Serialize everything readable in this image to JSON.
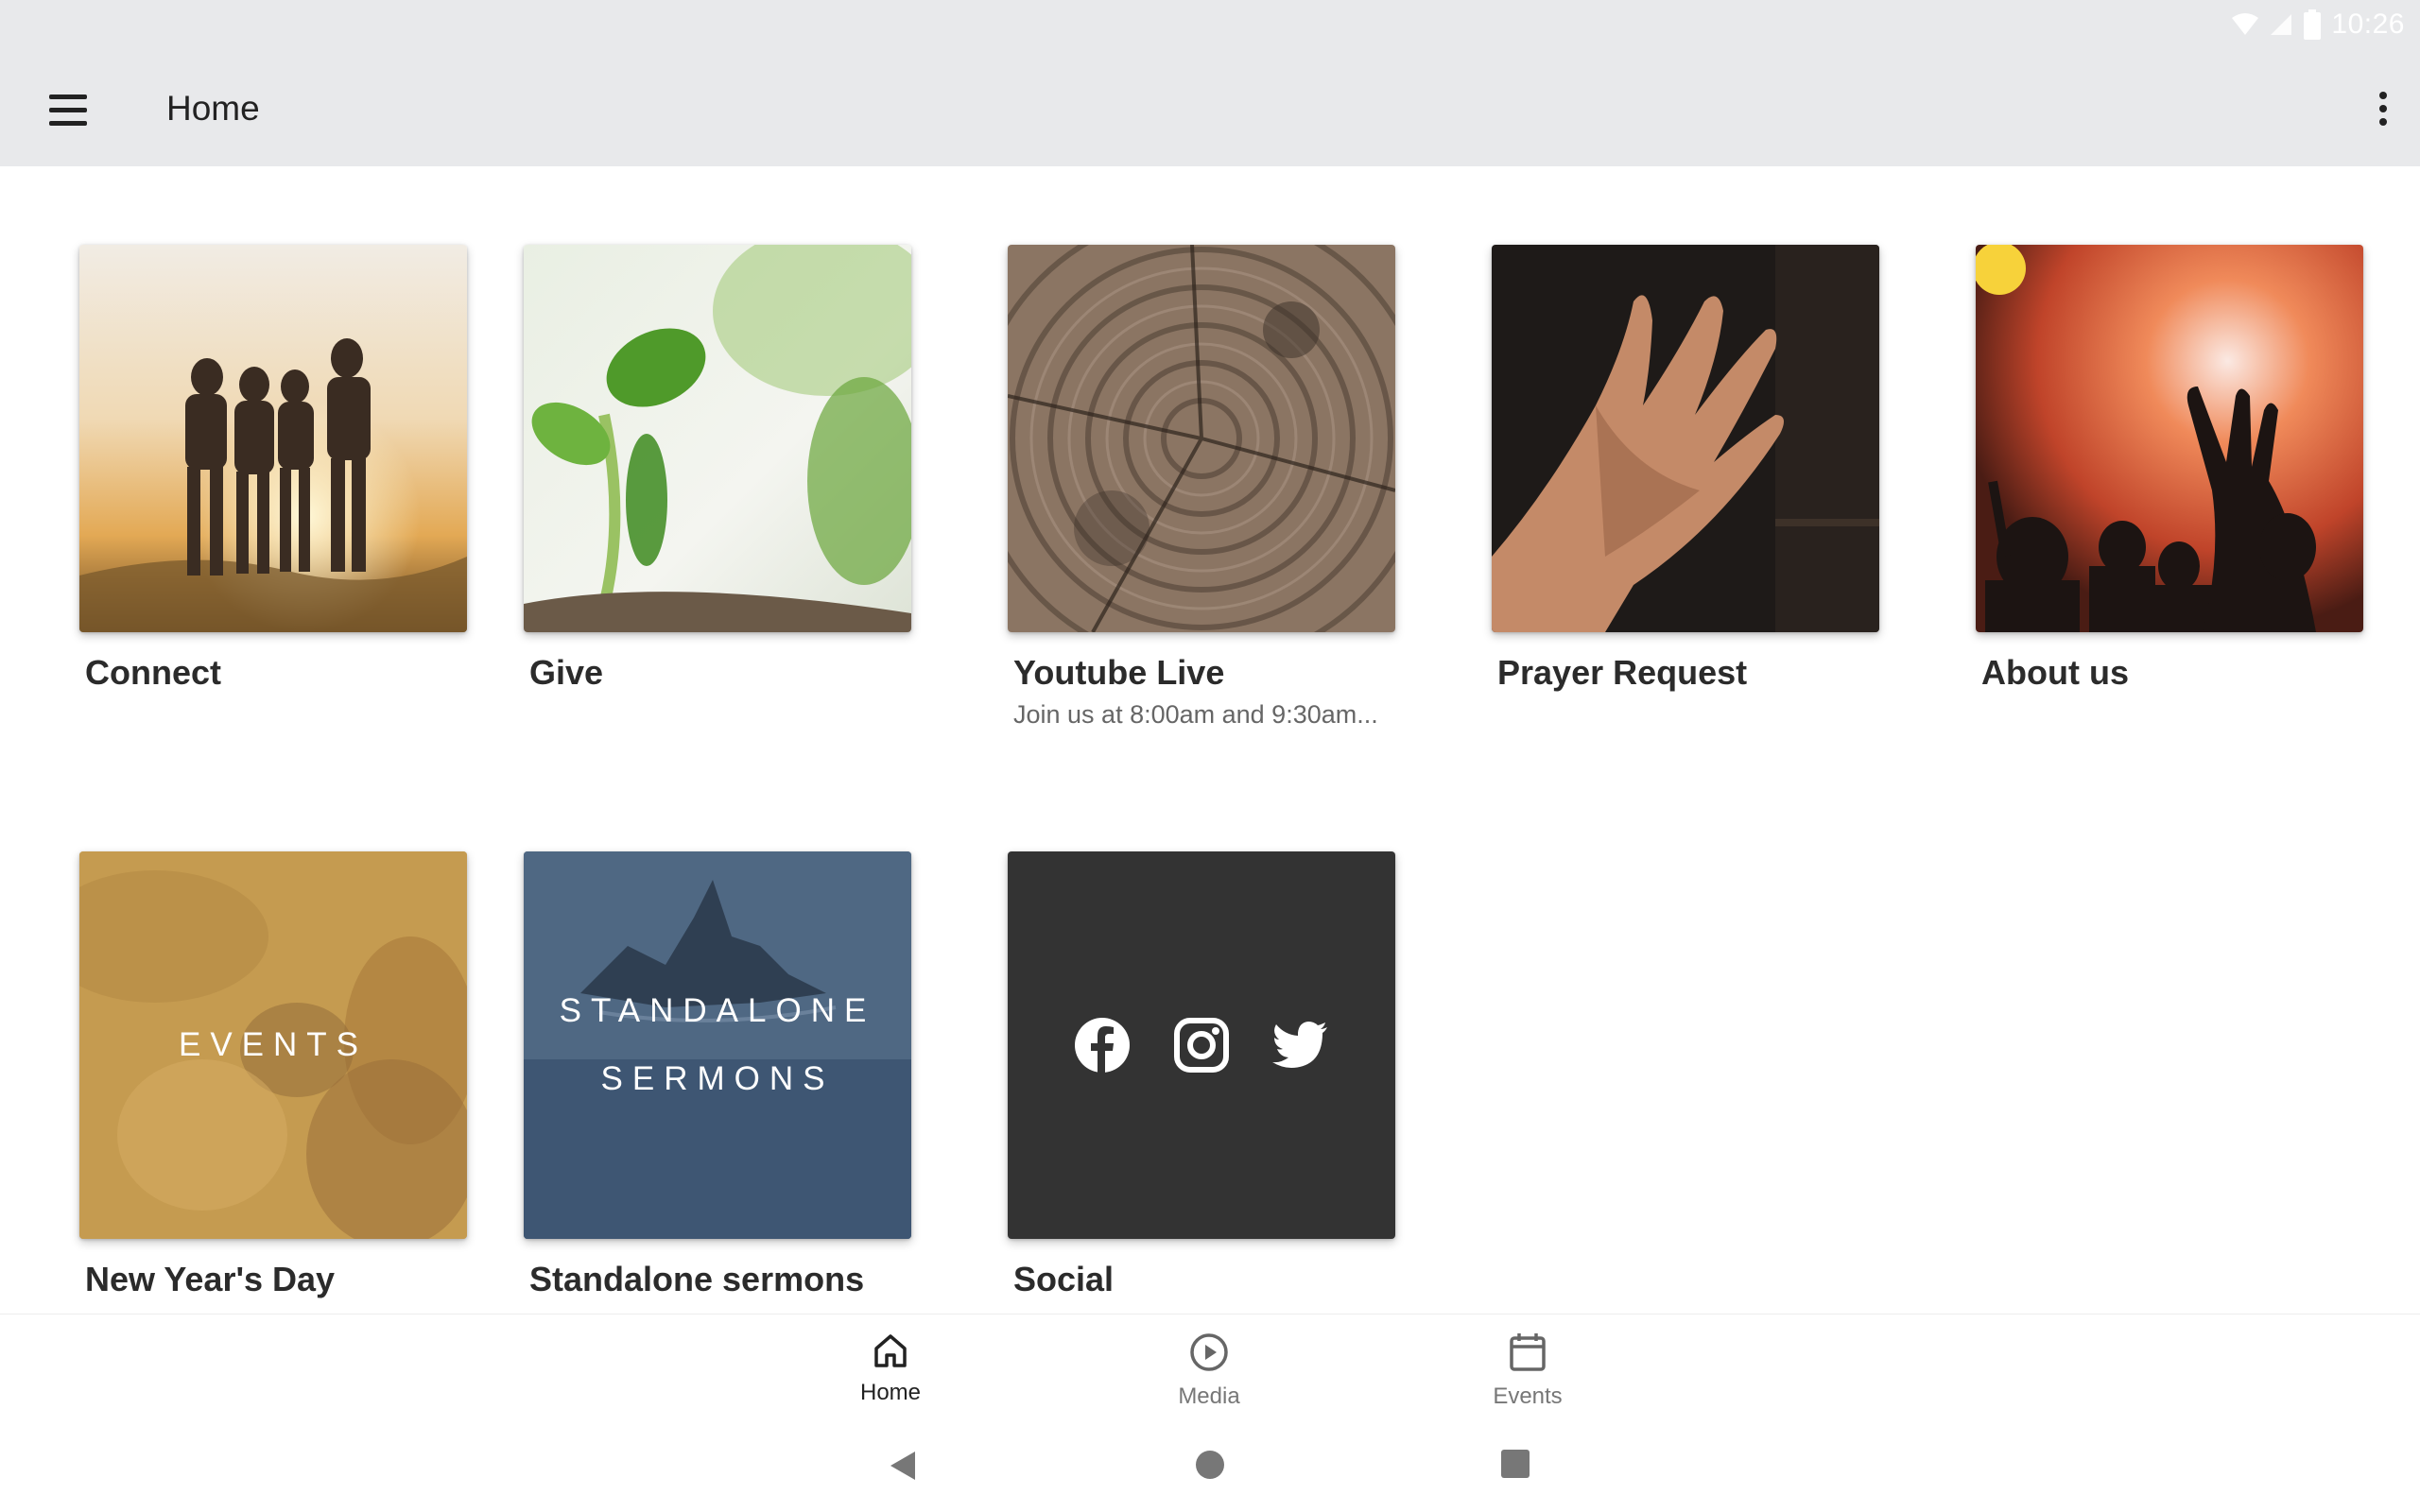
{
  "status_bar": {
    "time": "10:26"
  },
  "app_bar": {
    "title": "Home"
  },
  "tiles": [
    {
      "label": "Connect",
      "subtitle": ""
    },
    {
      "label": "Give",
      "subtitle": ""
    },
    {
      "label": "Youtube Live",
      "subtitle": "Join us at 8:00am and 9:30am..."
    },
    {
      "label": "Prayer Request",
      "subtitle": ""
    },
    {
      "label": "About us",
      "subtitle": ""
    },
    {
      "label": "New Year's Day",
      "subtitle": "",
      "thumb_text": [
        "EVENTS"
      ]
    },
    {
      "label": "Standalone sermons",
      "subtitle": "",
      "thumb_text": [
        "STANDALONE",
        "SERMONS"
      ]
    },
    {
      "label": "Social",
      "subtitle": "",
      "icons": [
        "facebook-icon",
        "instagram-icon",
        "twitter-icon"
      ]
    }
  ],
  "bottom_nav": {
    "items": [
      {
        "label": "Home",
        "icon": "home-icon",
        "active": true
      },
      {
        "label": "Media",
        "icon": "play-circle-icon",
        "active": false
      },
      {
        "label": "Events",
        "icon": "calendar-icon",
        "active": false
      }
    ]
  },
  "colors": {
    "app_bar_bg": "#e8e9eb",
    "social_tile_bg": "#333333",
    "events_tile_bg": "#c9a157",
    "sermons_tile_bg": "#4e6781"
  }
}
